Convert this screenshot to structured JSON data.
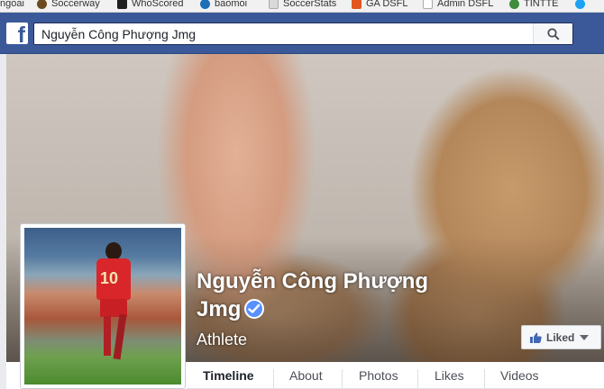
{
  "bookmarks": [
    {
      "label": "ngoai",
      "color": "#8a8a8a"
    },
    {
      "label": "Soccerway",
      "color": "#6b4a1e"
    },
    {
      "label": "WhoScored",
      "color": "#1e1e1e"
    },
    {
      "label": "baomoi",
      "color": "#1f6fb8"
    },
    {
      "label": "SoccerStats",
      "color": "#b5b5b5"
    },
    {
      "label": "GA DSFL",
      "color": "#e2561d"
    },
    {
      "label": "Admin DSFL",
      "color": "#d0d0d0"
    },
    {
      "label": "TINTTE",
      "color": "#3c8c3c"
    },
    {
      "label": "",
      "color": "#1da1f2"
    }
  ],
  "search": {
    "value": "Nguyễn Công Phượng Jmg"
  },
  "profile": {
    "name_line1": "Nguyễn Công Phượng",
    "name_line2": "Jmg",
    "category": "Athlete",
    "jersey_number": "10",
    "liked_label": "Liked"
  },
  "tabs": [
    {
      "label": "Timeline",
      "active": true
    },
    {
      "label": "About",
      "active": false
    },
    {
      "label": "Photos",
      "active": false
    },
    {
      "label": "Likes",
      "active": false
    },
    {
      "label": "Videos",
      "active": false
    }
  ],
  "colors": {
    "facebook_blue": "#3b5998",
    "verified_blue": "#5890ff"
  }
}
